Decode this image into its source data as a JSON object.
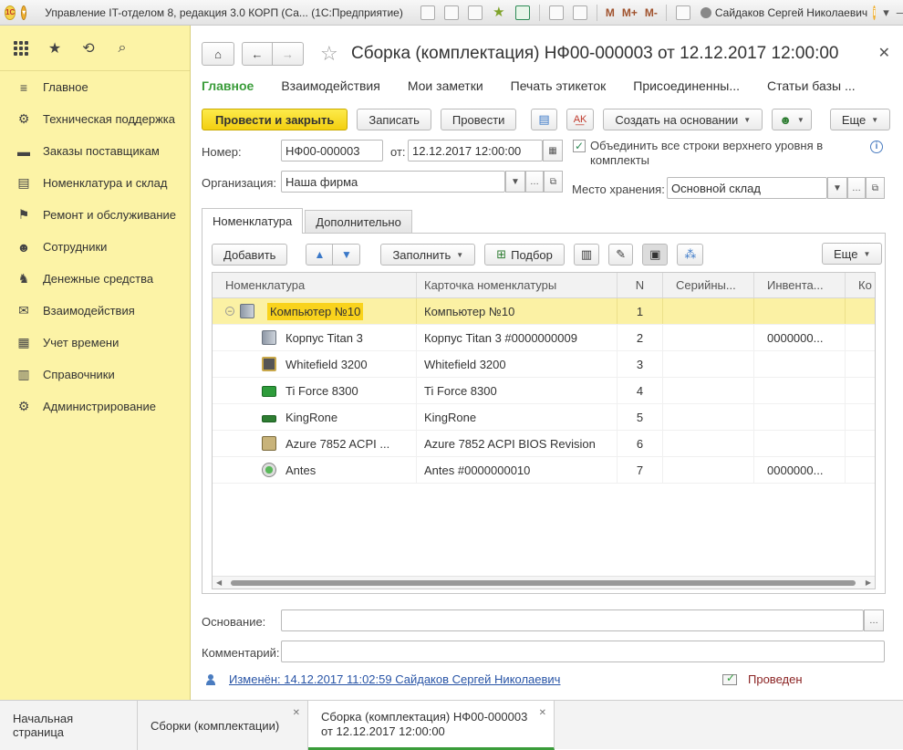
{
  "titlebar": {
    "title": "Управление IT-отделом 8, редакция 3.0 КОРП (Са...  (1С:Предприятие)",
    "m_buttons": [
      "M",
      "M+",
      "M-"
    ],
    "user": "Сайдаков Сергей Николаевич"
  },
  "sidebar": {
    "items": [
      {
        "label": "Главное",
        "icon": "menu-icon"
      },
      {
        "label": "Техническая поддержка",
        "icon": "support-icon"
      },
      {
        "label": "Заказы поставщикам",
        "icon": "truck-icon"
      },
      {
        "label": "Номенклатура и склад",
        "icon": "printer-icon"
      },
      {
        "label": "Ремонт и обслуживание",
        "icon": "flag-icon"
      },
      {
        "label": "Сотрудники",
        "icon": "people-icon"
      },
      {
        "label": "Денежные средства",
        "icon": "money-icon"
      },
      {
        "label": "Взаимодействия",
        "icon": "mail-icon"
      },
      {
        "label": "Учет времени",
        "icon": "calendar-icon"
      },
      {
        "label": "Справочники",
        "icon": "book-icon"
      },
      {
        "label": "Администрирование",
        "icon": "gear-icon"
      }
    ]
  },
  "header": {
    "title": "Сборка (комплектация) НФ00-000003 от 12.12.2017 12:00:00"
  },
  "sections": [
    "Главное",
    "Взаимодействия",
    "Мои заметки",
    "Печать этикеток",
    "Присоединенны...",
    "Статьи базы ..."
  ],
  "commands": {
    "post_close": "Провести и закрыть",
    "write": "Записать",
    "post": "Провести",
    "create_based": "Создать на основании",
    "more": "Еще"
  },
  "form": {
    "number_label": "Номер:",
    "number_value": "НФ00-000003",
    "date_label": "от:",
    "date_value": "12.12.2017 12:00:00",
    "org_label": "Организация:",
    "org_value": "Наша фирма",
    "checkbox_label": "Объединить все строки верхнего уровня в комплекты",
    "checkbox_checked": true,
    "storage_label": "Место хранения:",
    "storage_value": "Основной склад",
    "basis_label": "Основание:",
    "basis_value": "",
    "comment_label": "Комментарий:",
    "comment_value": ""
  },
  "tabs": [
    "Номенклатура",
    "Дополнительно"
  ],
  "panel_commands": {
    "add": "Добавить",
    "fill": "Заполнить",
    "pick": "Подбор",
    "more": "Еще"
  },
  "table": {
    "columns": [
      "Номенклатура",
      "Карточка номенклатуры",
      "N",
      "Серийны...",
      "Инвента...",
      "Ко"
    ],
    "rows": [
      {
        "name": "Компьютер №10",
        "card": "Компьютер №10",
        "n": "1",
        "serial": "",
        "inv": "",
        "icon": "computer-icon",
        "level": 0
      },
      {
        "name": "Корпус Titan 3",
        "card": "Корпус Titan 3 #0000000009",
        "n": "2",
        "serial": "",
        "inv": "0000000...",
        "icon": "case-icon",
        "level": 1
      },
      {
        "name": "Whitefield 3200",
        "card": "Whitefield 3200",
        "n": "3",
        "serial": "",
        "inv": "",
        "icon": "cpu-icon",
        "level": 1
      },
      {
        "name": "Ti Force 8300",
        "card": "Ti Force 8300",
        "n": "4",
        "serial": "",
        "inv": "",
        "icon": "gpu-icon",
        "level": 1
      },
      {
        "name": "KingRone",
        "card": "KingRone",
        "n": "5",
        "serial": "",
        "inv": "",
        "icon": "ram-icon",
        "level": 1
      },
      {
        "name": "Azure 7852 ACPI ...",
        "card": "Azure 7852 ACPI BIOS Revision",
        "n": "6",
        "serial": "",
        "inv": "",
        "icon": "motherboard-icon",
        "level": 1
      },
      {
        "name": "Antes",
        "card": "Antes #0000000010",
        "n": "7",
        "serial": "",
        "inv": "0000000...",
        "icon": "power-supply-icon",
        "level": 1
      }
    ]
  },
  "footer": {
    "changed": "Изменён: 14.12.2017 11:02:59 Сайдаков Сергей Николаевич",
    "status": "Проведен"
  },
  "bottom_tabs": [
    {
      "label": "Начальная страница",
      "closable": false,
      "active": false
    },
    {
      "label": "Сборки (комплектации)",
      "closable": true,
      "active": false
    },
    {
      "label": "Сборка (комплектация) НФ00-000003 от 12.12.2017 12:00:00",
      "closable": true,
      "active": true
    }
  ],
  "colors": {
    "sidebar_bg": "#fcf3a6",
    "primary_button": "#f3cf10",
    "active_section": "#3a9c3a",
    "selected_row": "#fbf1a4",
    "status_text": "#8b2323"
  }
}
